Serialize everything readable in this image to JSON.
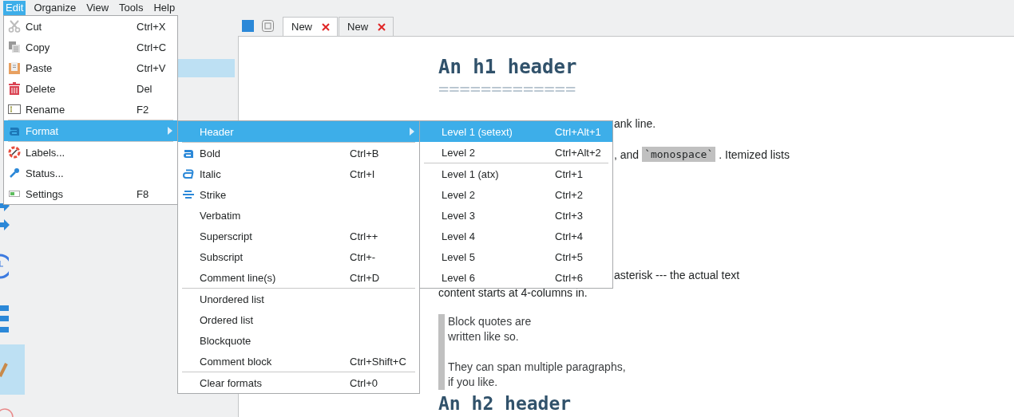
{
  "menubar": [
    {
      "label": "Edit",
      "selected": true
    },
    {
      "label": "Organize",
      "selected": false
    },
    {
      "label": "View",
      "selected": false
    },
    {
      "label": "Tools",
      "selected": false
    },
    {
      "label": "Help",
      "selected": false
    }
  ],
  "tabs": [
    {
      "label": "New",
      "selected": true
    },
    {
      "label": "New",
      "selected": false
    }
  ],
  "edit_menu": [
    {
      "kind": "item",
      "label": "Cut",
      "shortcut": "Ctrl+X",
      "selected": false
    },
    {
      "kind": "item",
      "label": "Copy",
      "shortcut": "Ctrl+C",
      "selected": false
    },
    {
      "kind": "item",
      "label": "Paste",
      "shortcut": "Ctrl+V",
      "selected": false
    },
    {
      "kind": "item",
      "label": "Delete",
      "shortcut": "Del",
      "selected": false
    },
    {
      "kind": "item",
      "label": "Rename",
      "shortcut": "F2",
      "selected": false
    },
    {
      "kind": "separator"
    },
    {
      "kind": "submenu",
      "label": "Format",
      "selected": true
    },
    {
      "kind": "separator"
    },
    {
      "kind": "item",
      "label": "Labels...",
      "selected": false
    },
    {
      "kind": "item",
      "label": "Status...",
      "selected": false
    },
    {
      "kind": "item",
      "label": "Settings",
      "shortcut": "F8",
      "selected": false
    }
  ],
  "format_menu": [
    {
      "kind": "submenu",
      "label": "Header",
      "selected": true
    },
    {
      "kind": "separator"
    },
    {
      "kind": "item",
      "label": "Bold",
      "shortcut": "Ctrl+B",
      "selected": false
    },
    {
      "kind": "item",
      "label": "Italic",
      "shortcut": "Ctrl+I",
      "selected": false
    },
    {
      "kind": "item",
      "label": "Strike",
      "selected": false
    },
    {
      "kind": "item",
      "label": "Verbatim",
      "selected": false
    },
    {
      "kind": "item",
      "label": "Superscript",
      "shortcut": "Ctrl++",
      "selected": false
    },
    {
      "kind": "item",
      "label": "Subscript",
      "shortcut": "Ctrl+-",
      "selected": false
    },
    {
      "kind": "item",
      "label": "Comment line(s)",
      "shortcut": "Ctrl+D",
      "selected": false
    },
    {
      "kind": "separator"
    },
    {
      "kind": "item",
      "label": "Unordered list",
      "selected": false
    },
    {
      "kind": "item",
      "label": "Ordered list",
      "selected": false
    },
    {
      "kind": "item",
      "label": "Blockquote",
      "selected": false
    },
    {
      "kind": "item",
      "label": "Comment block",
      "shortcut": "Ctrl+Shift+C",
      "selected": false
    },
    {
      "kind": "separator"
    },
    {
      "kind": "item",
      "label": "Clear formats",
      "shortcut": "Ctrl+0",
      "selected": false
    }
  ],
  "header_menu": [
    {
      "kind": "item",
      "label": "Level 1 (setext)",
      "shortcut": "Ctrl+Alt+1",
      "selected": true
    },
    {
      "kind": "item",
      "label": "Level 2",
      "shortcut": "Ctrl+Alt+2",
      "selected": false
    },
    {
      "kind": "separator"
    },
    {
      "kind": "item",
      "label": "Level 1 (atx)",
      "shortcut": "Ctrl+1",
      "selected": false
    },
    {
      "kind": "item",
      "label": "Level 2",
      "shortcut": "Ctrl+2",
      "selected": false
    },
    {
      "kind": "item",
      "label": "Level 3",
      "shortcut": "Ctrl+3",
      "selected": false
    },
    {
      "kind": "item",
      "label": "Level 4",
      "shortcut": "Ctrl+4",
      "selected": false
    },
    {
      "kind": "item",
      "label": "Level 5",
      "shortcut": "Ctrl+5",
      "selected": false
    },
    {
      "kind": "item",
      "label": "Level 6",
      "shortcut": "Ctrl+6",
      "selected": false
    }
  ],
  "document": [
    {
      "kind": "h1",
      "text": "An h1 header"
    },
    {
      "kind": "rule",
      "text": "============="
    },
    {
      "kind": "tail",
      "text": "ank line."
    },
    {
      "kind": "mixed",
      "parts": [
        {
          "kind": "text",
          "text": ", and"
        },
        {
          "kind": "code",
          "text": "`monospace`"
        },
        {
          "kind": "text",
          "text": ". Itemized lists"
        }
      ]
    },
    {
      "kind": "tail",
      "text": "asterisk --- the actual text"
    },
    {
      "kind": "para",
      "text": "content starts at 4-columns in."
    },
    {
      "kind": "blockquote",
      "paragraphs": [
        [
          "Block quotes are",
          "written like so."
        ],
        [
          "They can span multiple paragraphs,",
          "if you like."
        ]
      ]
    },
    {
      "kind": "h2",
      "text": "An h2 header"
    }
  ]
}
